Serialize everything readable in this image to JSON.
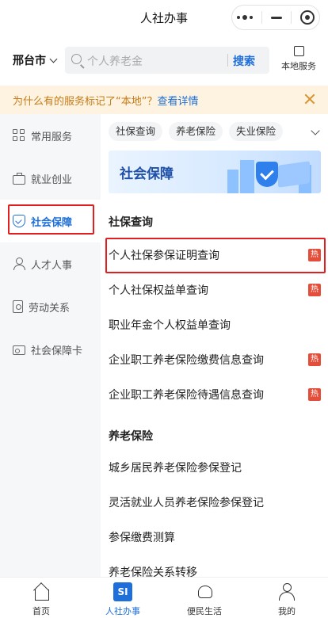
{
  "titlebar": {
    "title": "人社办事"
  },
  "search": {
    "city": "邢台市",
    "placeholder": "个人养老金",
    "button_label": "搜索",
    "local_service_label": "本地服务"
  },
  "notice": {
    "text": "为什么有的服务标记了“本地”？",
    "link": "查看详情"
  },
  "sidebar": {
    "items": [
      {
        "label": "常用服务",
        "icon": "grid-icon"
      },
      {
        "label": "就业创业",
        "icon": "briefcase-icon"
      },
      {
        "label": "社会保障",
        "icon": "shield-icon",
        "active": true
      },
      {
        "label": "人才人事",
        "icon": "person-icon"
      },
      {
        "label": "劳动关系",
        "icon": "document-icon"
      },
      {
        "label": "社会保障卡",
        "icon": "card-icon"
      }
    ]
  },
  "main": {
    "tags": [
      "社保查询",
      "养老保险",
      "失业保险"
    ],
    "banner_title": "社会保障",
    "sections": [
      {
        "title": "社保查询",
        "items": [
          {
            "label": "个人社保参保证明查询",
            "hot": true
          },
          {
            "label": "个人社保权益单查询",
            "hot": true
          },
          {
            "label": "职业年金个人权益单查询",
            "hot": false
          },
          {
            "label": "企业职工养老保险缴费信息查询",
            "hot": true
          },
          {
            "label": "企业职工养老保险待遇信息查询",
            "hot": true
          }
        ]
      },
      {
        "title": "养老保险",
        "items": [
          {
            "label": "城乡居民养老保险参保登记",
            "hot": false
          },
          {
            "label": "灵活就业人员养老保险参保登记",
            "hot": false
          },
          {
            "label": "参保缴费测算",
            "hot": false
          },
          {
            "label": "养老保险关系转移",
            "hot": false
          }
        ]
      }
    ],
    "hot_badge": "热"
  },
  "bottom_nav": {
    "items": [
      {
        "label": "首页",
        "icon": "home-icon"
      },
      {
        "label": "人社办事",
        "icon": "si-icon",
        "icon_text": "SI",
        "active": true
      },
      {
        "label": "便民生活",
        "icon": "handshake-icon"
      },
      {
        "label": "我的",
        "icon": "profile-icon"
      }
    ]
  },
  "colors": {
    "accent": "#1e6fd9",
    "highlight": "#e02020",
    "hot": "#e44d3a",
    "notice_bg": "#fdf3e0"
  }
}
